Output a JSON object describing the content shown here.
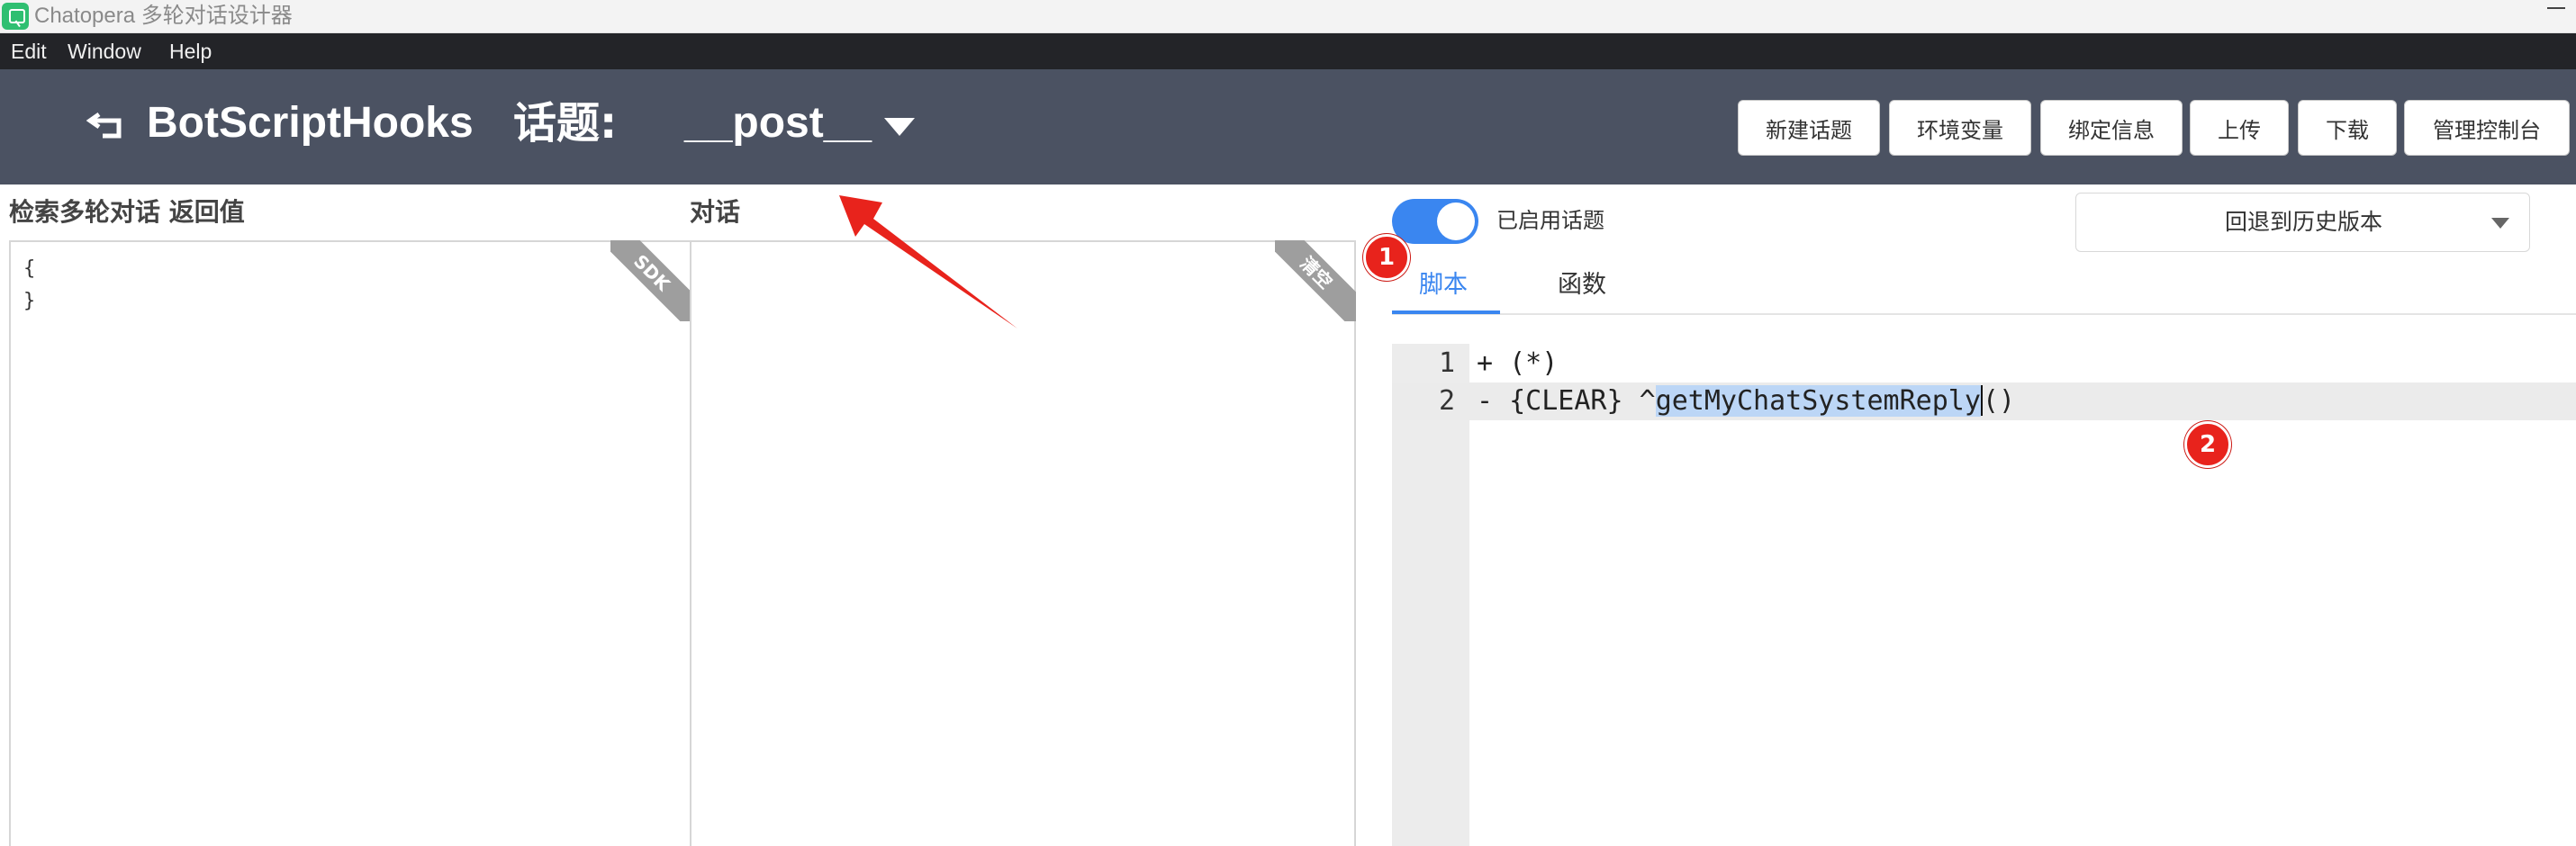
{
  "window": {
    "title": "Chatopera 多轮对话设计器"
  },
  "menu": {
    "items": [
      "Edit",
      "Window",
      "Help"
    ]
  },
  "header": {
    "bot_name": "BotScriptHooks",
    "topic_label": "话题:",
    "topic_value": "__post__",
    "buttons": [
      "新建话题",
      "环境变量",
      "绑定信息",
      "上传",
      "下载",
      "管理控制台"
    ]
  },
  "left_panel": {
    "label": "检索多轮对话 返回值",
    "content": "{\n}",
    "ribbon": "SDK"
  },
  "middle_panel": {
    "label": "对话",
    "ribbon": "清空"
  },
  "right_panel": {
    "toggle_label": "已启用话题",
    "toggle_on": true,
    "history_select": "回退到历史版本",
    "tabs": [
      "脚本",
      "函数"
    ],
    "active_tab": "脚本",
    "code": {
      "line_numbers": [
        "1",
        "2"
      ],
      "line1": "+ (*)",
      "line2_prefix": "- {CLEAR} ^",
      "line2_selected": "getMyChatSystemReply",
      "line2_suffix": "()"
    }
  },
  "annotations": {
    "badge1": "1",
    "badge2": "2"
  },
  "colors": {
    "header_bg": "#4b5262",
    "accent": "#3a86f0",
    "annotation": "#e8231c"
  }
}
